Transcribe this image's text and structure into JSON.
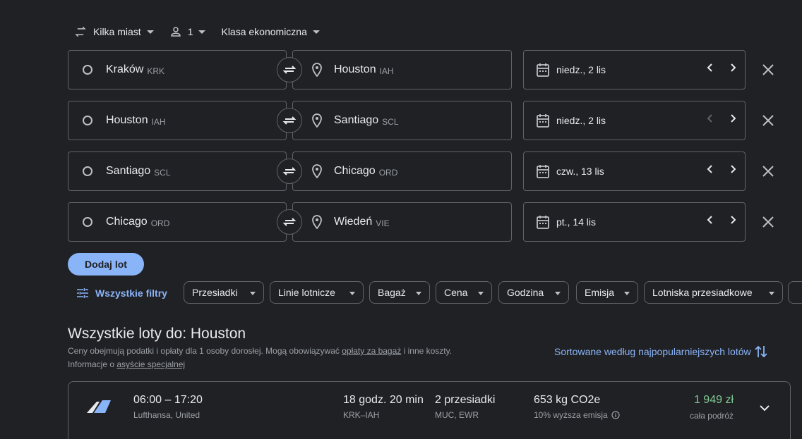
{
  "topbar": {
    "trip_type": "Kilka miast",
    "passengers": "1",
    "cabin_class": "Klasa ekonomiczna"
  },
  "legs": [
    {
      "origin": "Kraków",
      "origin_code": "KRK",
      "destination": "Houston",
      "destination_code": "IAH",
      "date": "niedz., 2 lis",
      "prev_enabled": true
    },
    {
      "origin": "Houston",
      "origin_code": "IAH",
      "destination": "Santiago",
      "destination_code": "SCL",
      "date": "niedz., 2 lis",
      "prev_enabled": false
    },
    {
      "origin": "Santiago",
      "origin_code": "SCL",
      "destination": "Chicago",
      "destination_code": "ORD",
      "date": "czw., 13 lis",
      "prev_enabled": true
    },
    {
      "origin": "Chicago",
      "origin_code": "ORD",
      "destination": "Wiedeń",
      "destination_code": "VIE",
      "date": "pt., 14 lis",
      "prev_enabled": true
    }
  ],
  "add_flight_label": "Dodaj lot",
  "filters": {
    "all_label": "Wszystkie filtry",
    "chips": [
      "Przesiadki",
      "Linie lotnicze",
      "Bagaż",
      "Cena",
      "Godzina",
      "Emisja",
      "Lotniska przesiadkowe"
    ]
  },
  "results": {
    "heading": "Wszystkie loty do: Houston",
    "note_prefix": "Ceny obejmują podatki i opłaty dla 1 osoby dorosłej. Mogą obowiązywać ",
    "note_link1": "opłaty za bagaż",
    "note_mid": " i inne koszty.",
    "note_line2_prefix": "Informacje o ",
    "note_link2": "asyście specjalnej",
    "sort_label": "Sortowane według najpopularniejszych lotów"
  },
  "flight": {
    "times": "06:00 – 17:20",
    "airlines": "Lufthansa, United",
    "duration": "18 godz. 20 min",
    "route": "KRK–IAH",
    "stops": "2 przesiadki",
    "via": "MUC, EWR",
    "co2": "653 kg CO2e",
    "emission": "10% wyższa emisja",
    "price": "1 949 zł",
    "price_note": "cała podróż"
  },
  "colors": {
    "background": "#202124",
    "accent": "#8ab4f8",
    "price": "#81c995",
    "border": "#5f6368"
  }
}
